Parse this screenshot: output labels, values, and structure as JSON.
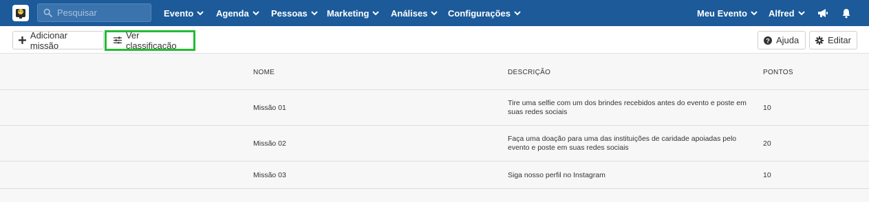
{
  "app": {
    "search_placeholder": "Pesquisar",
    "nav": [
      {
        "label": "Evento"
      },
      {
        "label": "Agenda"
      },
      {
        "label": "Pessoas"
      },
      {
        "label": "Marketing"
      },
      {
        "label": "Análises"
      },
      {
        "label": "Configurações"
      }
    ],
    "right_nav": {
      "event": "Meu Evento",
      "user": "Alfred"
    }
  },
  "toolbar": {
    "add_label": "Adicionar missão",
    "ranking_label": "Ver classificação",
    "help_label": "Ajuda",
    "edit_label": "Editar"
  },
  "table": {
    "headers": {
      "name": "NOME",
      "description": "DESCRIÇÃO",
      "points": "PONTOS"
    },
    "rows": [
      {
        "name": "Missão 01",
        "desc1": "Tire uma selfie com um dos brindes recebidos antes do evento e poste em",
        "desc2": "suas redes sociais",
        "points": "10"
      },
      {
        "name": "Missão 02",
        "desc1": "Faça uma doação para uma das instituições de caridade apoiadas pelo",
        "desc2": "evento e poste em suas redes sociais",
        "points": "20"
      },
      {
        "name": "Missão 03",
        "desc1": "Siga nosso perfil no Instagram",
        "desc2": "",
        "points": "10"
      }
    ]
  },
  "colors": {
    "topbar": "#1c5a99",
    "highlight": "#22bb33"
  }
}
